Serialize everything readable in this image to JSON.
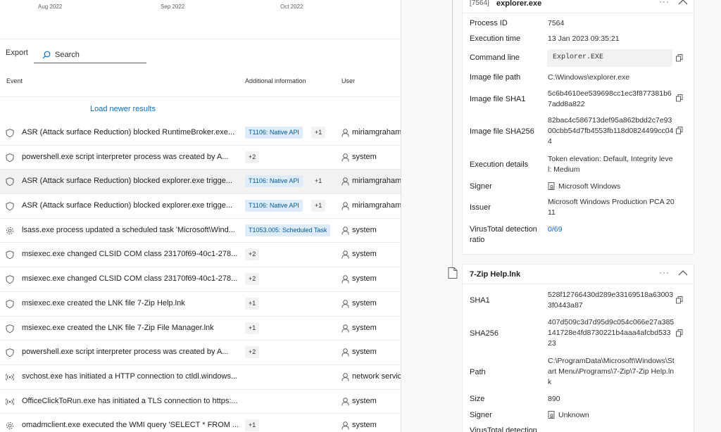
{
  "timeline": {
    "months": [
      "Aug 2022",
      "Sep 2022",
      "Oct 2022"
    ]
  },
  "toolbar": {
    "export_label": "Export",
    "search_placeholder": "Search"
  },
  "columns": {
    "event": "Event",
    "additional": "Additional information",
    "user": "User"
  },
  "load_newer": "Load newer results",
  "rows": [
    {
      "icon": "shield-icon",
      "text": "ASR (Attack surface Reduction) blocked RuntimeBroker.exe...",
      "tag": "T1106: Native API",
      "count": "+1",
      "user": "miriamgraham"
    },
    {
      "icon": "shield-icon",
      "text": "powershell.exe script interpreter process was created by A...",
      "tag": "",
      "count": "+2",
      "user": "system"
    },
    {
      "icon": "shield-icon",
      "text": "ASR (Attack surface Reduction) blocked explorer.exe trigge...",
      "tag": "T1106: Native API",
      "count": "+1",
      "user": "miriamgraham",
      "selected": true
    },
    {
      "icon": "shield-icon",
      "text": "ASR (Attack surface Reduction) blocked explorer.exe trigge...",
      "tag": "T1106: Native API",
      "count": "+1",
      "user": "miriamgraham"
    },
    {
      "icon": "gear-icon",
      "text": "lsass.exe process updated a scheduled task 'Microsoft\\Wind...",
      "tag": "T1053.005: Scheduled Task",
      "count": "",
      "user": "system"
    },
    {
      "icon": "shield-icon",
      "text": "msiexec.exe changed CLSID COM class 23170f69-40c1-278...",
      "tag": "",
      "count": "+2",
      "user": "system"
    },
    {
      "icon": "shield-icon",
      "text": "msiexec.exe changed CLSID COM class 23170f69-40c1-278...",
      "tag": "",
      "count": "+2",
      "user": "system"
    },
    {
      "icon": "shield-icon",
      "text": "msiexec.exe created the LNK file 7-Zip Help.lnk",
      "tag": "",
      "count": "+1",
      "user": "system"
    },
    {
      "icon": "shield-icon",
      "text": "msiexec.exe created the LNK file 7-Zip File Manager.lnk",
      "tag": "",
      "count": "+1",
      "user": "system"
    },
    {
      "icon": "shield-icon",
      "text": "powershell.exe script interpreter process was created by A...",
      "tag": "",
      "count": "+2",
      "user": "system"
    },
    {
      "icon": "network-icon",
      "text": "svchost.exe has initiated a HTTP connection to ctldl.windows...",
      "tag": "",
      "count": "",
      "user": "network service"
    },
    {
      "icon": "network-icon",
      "text": "OfficeClickToRun.exe has initiated a TLS connection to https:...",
      "tag": "",
      "count": "",
      "user": "system"
    },
    {
      "icon": "gear-icon",
      "text": "omadmclient.exe executed the WMI query 'SELECT * FROM ...",
      "tag": "",
      "count": "+1",
      "user": "system"
    }
  ],
  "process_card": {
    "pid_label": "[7564]",
    "title": "explorer.exe",
    "fields": {
      "process_id": {
        "label": "Process ID",
        "value": "7564"
      },
      "execution_time": {
        "label": "Execution time",
        "value": "13 Jan 2023 09:35:21"
      },
      "command_line": {
        "label": "Command line",
        "value": "Explorer.EXE"
      },
      "image_path": {
        "label": "Image file path",
        "value": "C:\\Windows\\explorer.exe"
      },
      "image_sha1": {
        "label": "Image file SHA1",
        "value": "5c6b4610ee539698cc1ec3f877381b67add8a822"
      },
      "image_sha256": {
        "label": "Image file SHA256",
        "value": "82bac4c586713def95a862bdd2c7e9300cbb54d7fb4553fb118d0824499cc044"
      },
      "execution_details": {
        "label": "Execution details",
        "value": "Token elevation: Default, Integrity level: Medium"
      },
      "signer": {
        "label": "Signer",
        "value": "Microsoft Windows"
      },
      "issuer": {
        "label": "Issuer",
        "value": "Microsoft Windows Production PCA 2011"
      },
      "virustotal": {
        "label": "VirusTotal detection ratio",
        "value": "0/69"
      }
    }
  },
  "file_card": {
    "title": "7-Zip Help.lnk",
    "fields": {
      "sha1": {
        "label": "SHA1",
        "value": "528f12766430d289e33169518a630033f0443a87"
      },
      "sha256": {
        "label": "SHA256",
        "value": "407d509c3d7d95d9c054c066e27a385141728e4fd8730221b4aaa4afcbd53323"
      },
      "path": {
        "label": "Path",
        "value": "C:\\ProgramData\\Microsoft\\Windows\\Start Menu\\Programs\\7-Zip\\7-Zip Help.lnk"
      },
      "size": {
        "label": "Size",
        "value": "890"
      },
      "signer": {
        "label": "Signer",
        "value": "Unknown"
      },
      "virustotal": {
        "label": "VirusTotal detection"
      }
    }
  },
  "card_actions": {
    "more": "···"
  },
  "colors": {
    "accent": "#0f6cbd",
    "tag_bg": "#deecf9",
    "tag_fg": "#005a9e",
    "selected_row": "#f3f2f1"
  }
}
